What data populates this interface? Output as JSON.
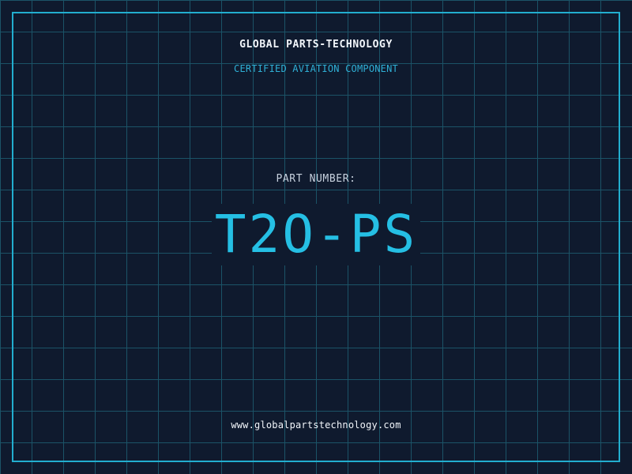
{
  "header": {
    "company": "GLOBAL PARTS-TECHNOLOGY",
    "subtitle": "CERTIFIED AVIATION COMPONENT"
  },
  "part": {
    "label": "PART NUMBER:",
    "number": "T2O-PS"
  },
  "footer": {
    "website": "www.globalpartstechnology.com"
  },
  "colors": {
    "background": "#0f1a2e",
    "grid": "#1d5a6e",
    "accent": "#22aecf",
    "primary_text": "#f2f6fb"
  }
}
